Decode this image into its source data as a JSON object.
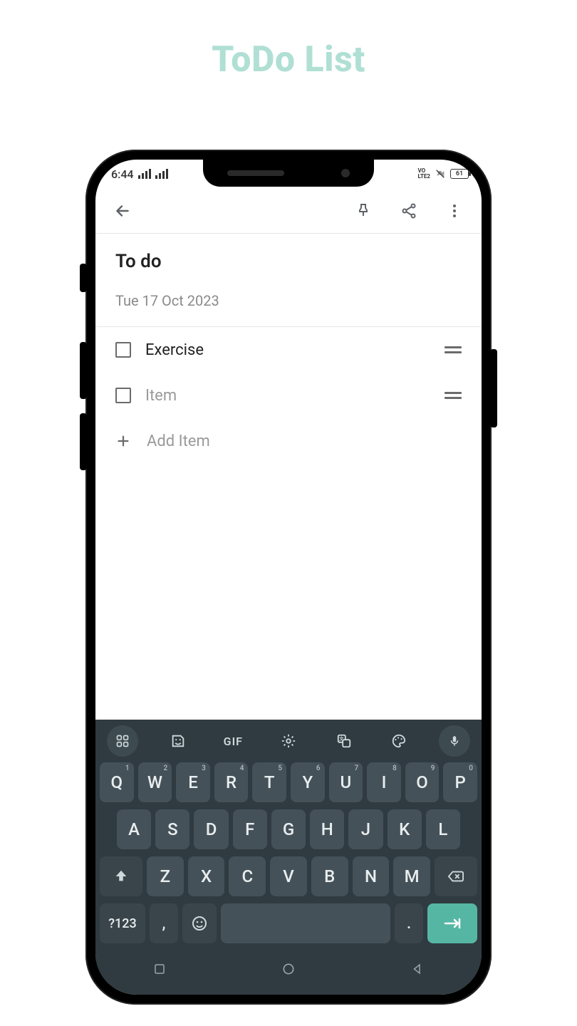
{
  "page": {
    "title": "ToDo List"
  },
  "statusbar": {
    "time": "6:44",
    "volte": "VO\nLTE2",
    "battery": "61"
  },
  "note": {
    "title": "To do",
    "date": "Tue 17 Oct 2023",
    "items": [
      {
        "label": "Exercise",
        "placeholder": false
      },
      {
        "label": "Item",
        "placeholder": true
      }
    ],
    "add_label": "Add Item"
  },
  "keyboard": {
    "gif": "GIF",
    "row1": [
      "Q",
      "W",
      "E",
      "R",
      "T",
      "Y",
      "U",
      "I",
      "O",
      "P"
    ],
    "row1_sup": [
      "1",
      "2",
      "3",
      "4",
      "5",
      "6",
      "7",
      "8",
      "9",
      "0"
    ],
    "row2": [
      "A",
      "S",
      "D",
      "F",
      "G",
      "H",
      "J",
      "K",
      "L"
    ],
    "row3": [
      "Z",
      "X",
      "C",
      "V",
      "B",
      "N",
      "M"
    ],
    "sym": "?123",
    "comma": ",",
    "period": "."
  }
}
